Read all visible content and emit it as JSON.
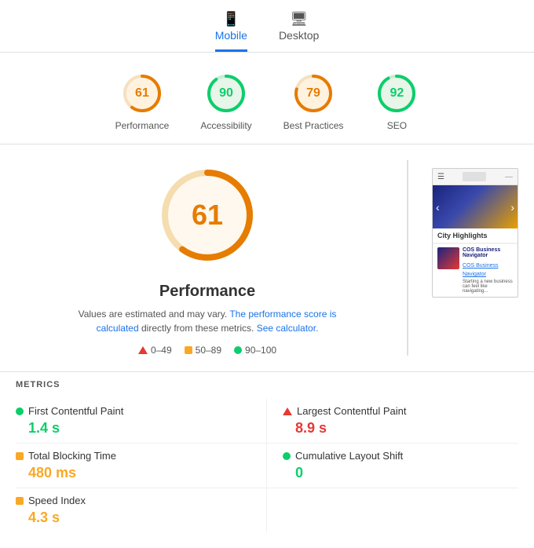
{
  "tabs": [
    {
      "id": "mobile",
      "label": "Mobile",
      "active": true,
      "icon": "📱"
    },
    {
      "id": "desktop",
      "label": "Desktop",
      "active": false,
      "icon": "🖥"
    }
  ],
  "scores": [
    {
      "id": "performance",
      "value": 61,
      "label": "Performance",
      "color": "#e67c00",
      "bg": "#fff3e0",
      "stroke": "#e67c00",
      "trackColor": "#f5e0c0"
    },
    {
      "id": "accessibility",
      "value": 90,
      "label": "Accessibility",
      "color": "#0cce6b",
      "bg": "#e8f5e9",
      "stroke": "#0cce6b",
      "trackColor": "#c8ecd8"
    },
    {
      "id": "best-practices",
      "value": 79,
      "label": "Best Practices",
      "color": "#e67c00",
      "bg": "#fff3e0",
      "stroke": "#e67c00",
      "trackColor": "#f5e0c0"
    },
    {
      "id": "seo",
      "value": 92,
      "label": "SEO",
      "color": "#0cce6b",
      "bg": "#e8f5e9",
      "stroke": "#0cce6b",
      "trackColor": "#c8ecd8"
    }
  ],
  "main": {
    "large_score": 61,
    "title": "Performance",
    "desc_text": "Values are estimated and may vary. ",
    "desc_link1": "The performance score is calculated",
    "desc_mid": " directly from these metrics. ",
    "desc_link2": "See calculator.",
    "legend": [
      {
        "type": "red-triangle",
        "label": "0–49"
      },
      {
        "type": "orange-square",
        "label": "50–89"
      },
      {
        "type": "green-circle",
        "label": "90–100"
      }
    ]
  },
  "mock_browser": {
    "city_highlights": "City Highlights",
    "cos_title": "COS Business Navigator",
    "cos_link": "COS Business Navigator",
    "footer_text": "Starting a new business can feel like navigating..."
  },
  "metrics": {
    "section_label": "METRICS",
    "items": [
      {
        "id": "fcp",
        "name": "First Contentful Paint",
        "value": "1.4 s",
        "type": "green"
      },
      {
        "id": "lcp",
        "name": "Largest Contentful Paint",
        "value": "8.9 s",
        "type": "red"
      },
      {
        "id": "tbt",
        "name": "Total Blocking Time",
        "value": "480 ms",
        "type": "orange"
      },
      {
        "id": "cls",
        "name": "Cumulative Layout Shift",
        "value": "0",
        "type": "green"
      },
      {
        "id": "si",
        "name": "Speed Index",
        "value": "4.3 s",
        "type": "orange"
      }
    ]
  }
}
